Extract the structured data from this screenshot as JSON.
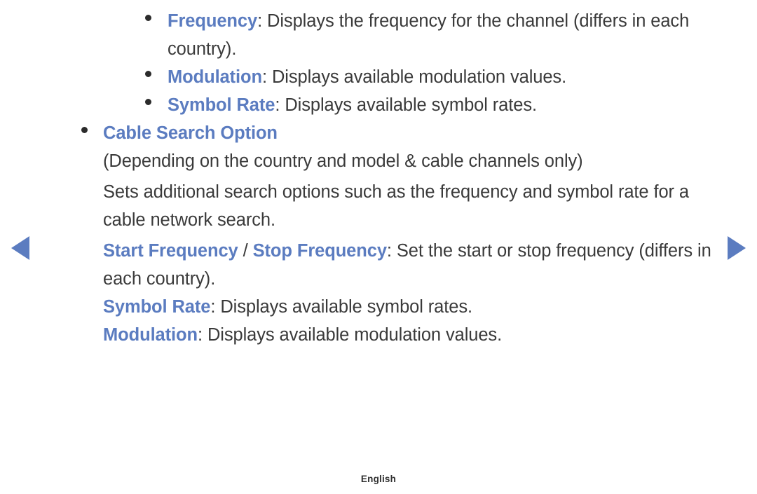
{
  "nav": {
    "prev_label": "Previous page",
    "next_label": "Next page",
    "arrow_color": "#5b7cc0"
  },
  "colors": {
    "term_blue": "#5b7cc0",
    "body_text": "#3a3a3a",
    "bullet": "#2b2b2b",
    "background": "#ffffff"
  },
  "content": {
    "items": [
      {
        "level": 2,
        "term": "Frequency",
        "separator": ": ",
        "description": "Displays the frequency for the channel (differs in each country)."
      },
      {
        "level": 2,
        "term": "Modulation",
        "separator": ": ",
        "description": "Displays available modulation values."
      },
      {
        "level": 2,
        "term": "Symbol Rate",
        "separator": ": ",
        "description": "Displays available symbol rates."
      },
      {
        "level": 1,
        "term": "Cable Search Option",
        "separator": "",
        "description": ""
      }
    ],
    "paragraphs": [
      {
        "text": "(Depending on the country and model & cable channels only)"
      },
      {
        "text": "Sets additional search options such as the frequency and symbol rate for a cable network search."
      }
    ],
    "sub_options": [
      {
        "term_a": "Start Frequency",
        "term_divider": " / ",
        "term_b": "Stop Frequency",
        "separator": ": ",
        "description": "Set the start or stop frequency (differs in each country)."
      },
      {
        "term_a": "Symbol Rate",
        "term_divider": "",
        "term_b": "",
        "separator": ": ",
        "description": "Displays available symbol rates."
      },
      {
        "term_a": "Modulation",
        "term_divider": "",
        "term_b": "",
        "separator": ": ",
        "description": "Displays available modulation values."
      }
    ]
  },
  "footer": {
    "language": "English"
  }
}
